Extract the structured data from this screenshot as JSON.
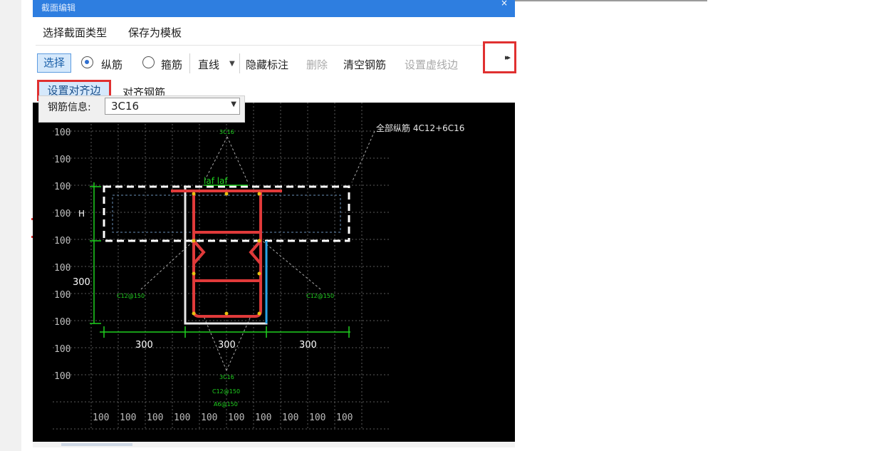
{
  "window": {
    "title": "截面编辑",
    "close_glyph": "×"
  },
  "menu": {
    "items": [
      "选择截面类型",
      "保存为模板"
    ]
  },
  "toolbar": {
    "select_label": "选择",
    "longitudinal_label": "纵筋",
    "stirrup_label": "箍筋",
    "line_label": "直线",
    "line_caret": "▼",
    "hide_label": "隐藏标注",
    "delete_label": "删除",
    "clear_label": "清空钢筋",
    "dashed_edge_label": "设置虚线边",
    "more_glyph": "▸▸",
    "selected_mode": "纵筋"
  },
  "second_row": {
    "set_align_edge": "设置对齐边",
    "align_rebar": "对齐钢筋"
  },
  "rebar_info": {
    "label": "钢筋信息:",
    "value": "3C16",
    "caret": "▼"
  },
  "drawing": {
    "grid_label": "100",
    "all_rebar_note": "全部纵筋 4C12+6C16",
    "top_rebar": "3C16",
    "la_label": "laf laf",
    "height_label": "H",
    "left_dim": "300",
    "left_stirrup": "C12@150",
    "right_stirrup": "C12@150",
    "bottom_dims": [
      "300",
      "300",
      "300"
    ],
    "bottom_rebar": "3C16",
    "bottom_stirrup": "C12@150",
    "bottom_tie": "A6@150"
  },
  "colors": {
    "accent_blue": "#2e7ee0",
    "highlight_red": "#e03030",
    "rebar_red": "#e03a3a",
    "dim_green": "#1fd01f",
    "canvas_bg": "#000000"
  }
}
